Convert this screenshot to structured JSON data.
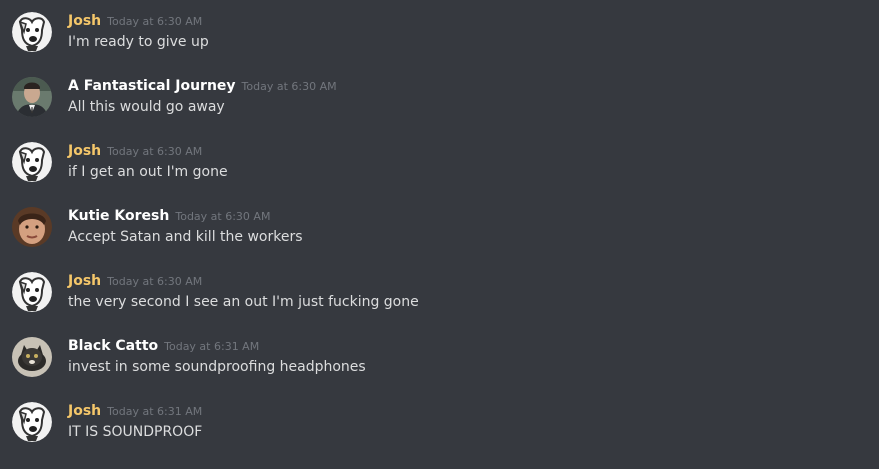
{
  "colors": {
    "background": "#36393f",
    "josh_name": "#f5c76a",
    "default_name": "#ffffff",
    "timestamp": "#72767d",
    "message_text": "#dcddde"
  },
  "messages": [
    {
      "author": "Josh",
      "author_color": "#f5c76a",
      "avatar": "dog-avatar",
      "timestamp": "Today at 6:30 AM",
      "text": "I'm ready to give up"
    },
    {
      "author": "A Fantastical Journey",
      "author_color": "#ffffff",
      "avatar": "man-suit-avatar",
      "timestamp": "Today at 6:30 AM",
      "text": "All this would go away"
    },
    {
      "author": "Josh",
      "author_color": "#f5c76a",
      "avatar": "dog-avatar",
      "timestamp": "Today at 6:30 AM",
      "text": "if I get an out I'm gone"
    },
    {
      "author": "Kutie Koresh",
      "author_color": "#ffffff",
      "avatar": "face-avatar",
      "timestamp": "Today at 6:30 AM",
      "text": "Accept Satan and kill the workers"
    },
    {
      "author": "Josh",
      "author_color": "#f5c76a",
      "avatar": "dog-avatar",
      "timestamp": "Today at 6:30 AM",
      "text": "the very second I see an out I'm just fucking gone"
    },
    {
      "author": "Black Catto",
      "author_color": "#ffffff",
      "avatar": "cat-avatar",
      "timestamp": "Today at 6:31 AM",
      "text": "invest in some soundproofing headphones"
    },
    {
      "author": "Josh",
      "author_color": "#f5c76a",
      "avatar": "dog-avatar",
      "timestamp": "Today at 6:31 AM",
      "text": "IT IS SOUNDPROOF"
    }
  ]
}
